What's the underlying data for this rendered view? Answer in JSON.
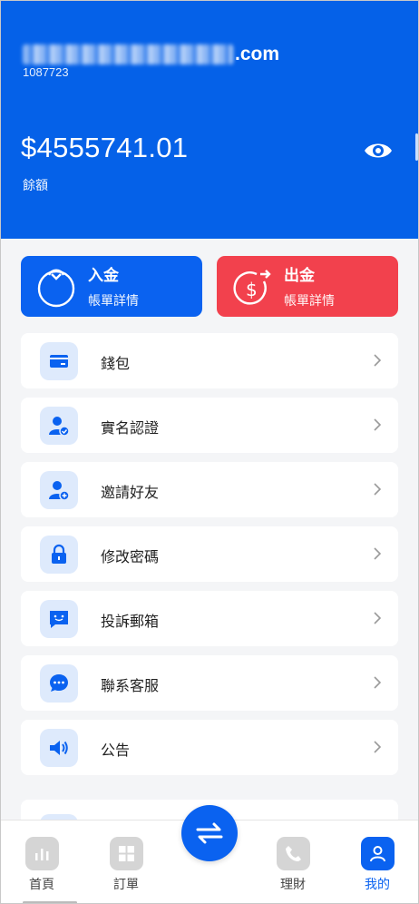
{
  "account": {
    "email_suffix": ".com",
    "uid": "1087723",
    "balance": "$4555741.01",
    "balance_label": "餘額"
  },
  "actions": {
    "deposit": {
      "title": "入金",
      "subtitle": "帳單詳情"
    },
    "withdraw": {
      "title": "出金",
      "subtitle": "帳單詳情"
    }
  },
  "menu": [
    {
      "label": "錢包",
      "icon": "wallet-icon"
    },
    {
      "label": "實名認證",
      "icon": "verified-user-icon"
    },
    {
      "label": "邀請好友",
      "icon": "add-user-icon"
    },
    {
      "label": "修改密碼",
      "icon": "lock-icon"
    },
    {
      "label": "投訴郵箱",
      "icon": "feedback-icon"
    },
    {
      "label": "聯系客服",
      "icon": "chat-icon"
    },
    {
      "label": "公告",
      "icon": "speaker-icon"
    }
  ],
  "tabbar": {
    "home": "首頁",
    "orders": "訂單",
    "finance": "理財",
    "mine": "我的"
  },
  "colors": {
    "brand": "#0561e8",
    "withdraw": "#f2414d",
    "icon_bg": "#deeafc"
  }
}
